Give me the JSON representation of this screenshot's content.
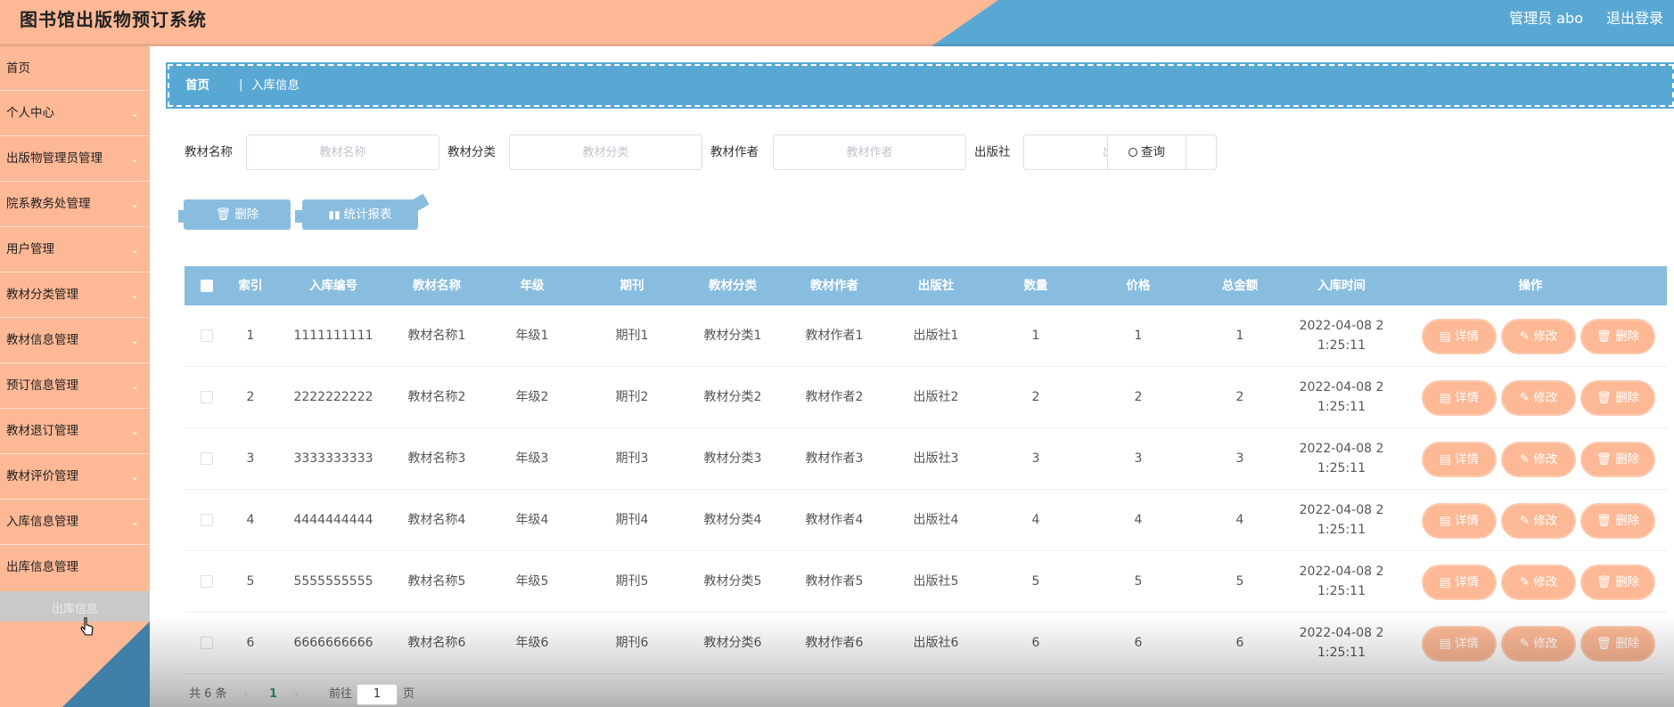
{
  "header": {
    "title": "图书馆出版物预订系统",
    "user": "管理员 abo",
    "logout": "退出登录"
  },
  "sidebar": {
    "items": [
      {
        "label": "首页",
        "chevron": false
      },
      {
        "label": "个人中心",
        "chevron": true
      },
      {
        "label": "出版物管理员管理",
        "chevron": true
      },
      {
        "label": "院系教务处管理",
        "chevron": true
      },
      {
        "label": "用户管理",
        "chevron": true
      },
      {
        "label": "教材分类管理",
        "chevron": true
      },
      {
        "label": "教材信息管理",
        "chevron": true
      },
      {
        "label": "预订信息管理",
        "chevron": true
      },
      {
        "label": "教材退订管理",
        "chevron": true
      },
      {
        "label": "教材评价管理",
        "chevron": true
      },
      {
        "label": "入库信息管理",
        "chevron": true
      },
      {
        "label": "出库信息管理",
        "chevron": false
      }
    ],
    "submenu": "出库信息"
  },
  "breadcrumb": {
    "home": "首页",
    "sep": "|",
    "current": "入库信息"
  },
  "search": {
    "fields": [
      {
        "label": "教材名称",
        "placeholder": "教材名称"
      },
      {
        "label": "教材分类",
        "placeholder": "教材分类"
      },
      {
        "label": "教材作者",
        "placeholder": "教材作者"
      },
      {
        "label": "出版社",
        "placeholder": "出版社"
      }
    ],
    "button": "查询"
  },
  "actions": {
    "delete": "删除",
    "report": "统计报表"
  },
  "table": {
    "headers": [
      "索引",
      "入库编号",
      "教材名称",
      "年级",
      "期刊",
      "教材分类",
      "教材作者",
      "出版社",
      "数量",
      "价格",
      "总金额",
      "入库时间",
      "操作"
    ],
    "rows": [
      [
        "1",
        "1111111111",
        "教材名称1",
        "年级1",
        "期刊1",
        "教材分类1",
        "教材作者1",
        "出版社1",
        "1",
        "1",
        "1",
        "2022-04-08 2",
        "1:25:11"
      ],
      [
        "2",
        "2222222222",
        "教材名称2",
        "年级2",
        "期刊2",
        "教材分类2",
        "教材作者2",
        "出版社2",
        "2",
        "2",
        "2",
        "2022-04-08 2",
        "1:25:11"
      ],
      [
        "3",
        "3333333333",
        "教材名称3",
        "年级3",
        "期刊3",
        "教材分类3",
        "教材作者3",
        "出版社3",
        "3",
        "3",
        "3",
        "2022-04-08 2",
        "1:25:11"
      ],
      [
        "4",
        "4444444444",
        "教材名称4",
        "年级4",
        "期刊4",
        "教材分类4",
        "教材作者4",
        "出版社4",
        "4",
        "4",
        "4",
        "2022-04-08 2",
        "1:25:11"
      ],
      [
        "5",
        "5555555555",
        "教材名称5",
        "年级5",
        "期刊5",
        "教材分类5",
        "教材作者5",
        "出版社5",
        "5",
        "5",
        "5",
        "2022-04-08 2",
        "1:25:11"
      ],
      [
        "6",
        "6666666666",
        "教材名称6",
        "年级6",
        "期刊6",
        "教材分类6",
        "教材作者6",
        "出版社6",
        "6",
        "6",
        "6",
        "2022-04-08 2",
        "1:25:11"
      ]
    ],
    "ops": {
      "detail": "详情",
      "edit": "修改",
      "delete": "删除"
    }
  },
  "pager": {
    "total": "共 6 条",
    "prev": "‹",
    "current": "1",
    "next": "›",
    "goto_prefix": "前往",
    "goto_value": "1",
    "goto_suffix": "页"
  },
  "colors": {
    "salmon": "#fdb895",
    "blue": "#59a8d4",
    "table_head": "#89bde0"
  }
}
